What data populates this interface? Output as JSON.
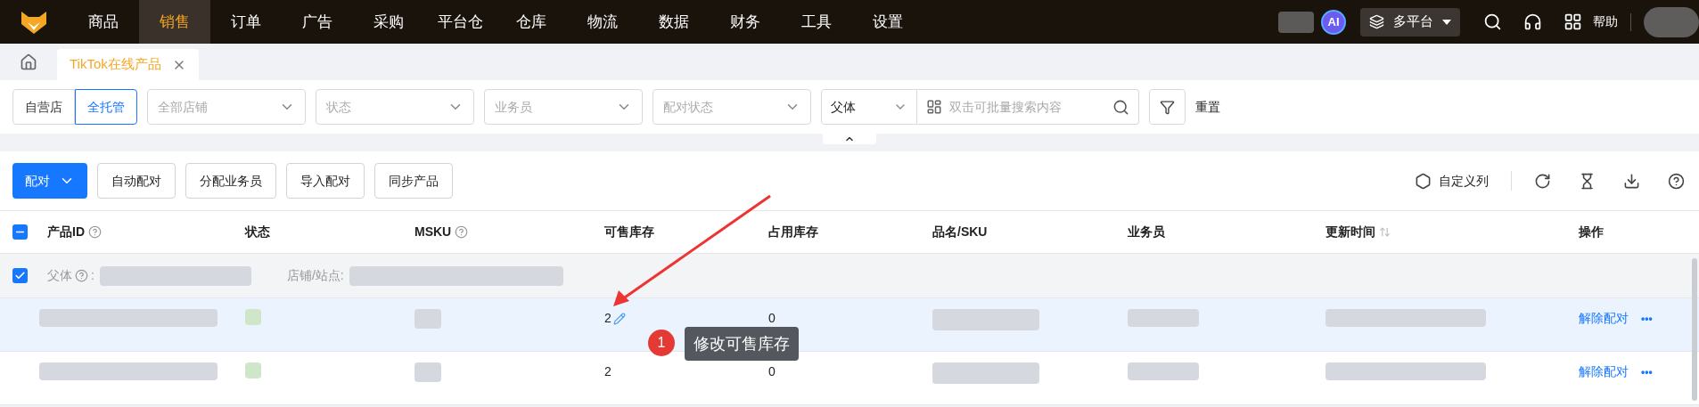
{
  "nav": {
    "items": [
      {
        "label": "商品",
        "selected": false
      },
      {
        "label": "销售",
        "selected": true
      },
      {
        "label": "订单",
        "selected": false
      },
      {
        "label": "广告",
        "selected": false
      },
      {
        "label": "采购",
        "selected": false
      },
      {
        "label": "平台仓",
        "selected": false
      },
      {
        "label": "仓库",
        "selected": false
      },
      {
        "label": "物流",
        "selected": false
      },
      {
        "label": "数据",
        "selected": false
      },
      {
        "label": "财务",
        "selected": false
      },
      {
        "label": "工具",
        "selected": false
      },
      {
        "label": "设置",
        "selected": false
      }
    ],
    "ai_badge": "AI",
    "platform": "多平台",
    "help": "帮助"
  },
  "tabs": [
    {
      "label": "TikTok在线产品",
      "selected": true
    }
  ],
  "filters": {
    "segments": [
      {
        "label": "自营店",
        "selected": false
      },
      {
        "label": "全托管",
        "selected": true
      }
    ],
    "selects": [
      {
        "placeholder": "全部店铺"
      },
      {
        "placeholder": "状态"
      },
      {
        "placeholder": "业务员"
      },
      {
        "placeholder": "配对状态"
      }
    ],
    "search_type": "父体",
    "search_placeholder": "双击可批量搜索内容",
    "reset": "重置"
  },
  "actions": {
    "primary": "配对",
    "buttons": [
      "自动配对",
      "分配业务员",
      "导入配对",
      "同步产品"
    ],
    "custom_columns": "自定义列"
  },
  "table": {
    "header_indeterminate": true,
    "columns": [
      {
        "label": "产品ID",
        "help": true,
        "sortable": false
      },
      {
        "label": "状态",
        "help": false,
        "sortable": false
      },
      {
        "label": "MSKU",
        "help": true,
        "sortable": false
      },
      {
        "label": "可售库存",
        "help": false,
        "sortable": false
      },
      {
        "label": "占用库存",
        "help": false,
        "sortable": false
      },
      {
        "label": "品名/SKU",
        "help": false,
        "sortable": false
      },
      {
        "label": "业务员",
        "help": false,
        "sortable": false
      },
      {
        "label": "更新时间",
        "help": false,
        "sortable": true
      },
      {
        "label": "操作",
        "help": false,
        "sortable": false
      }
    ],
    "group": {
      "checked": true,
      "parent_label": "父体",
      "parent_colon": ":",
      "store_label": "店铺/站点:"
    },
    "rows": [
      {
        "highlighted": true,
        "stock": "2",
        "edit_icon": true,
        "occupied": "0",
        "action": "解除配对",
        "more": "•••"
      },
      {
        "highlighted": false,
        "stock": "2",
        "edit_icon": false,
        "occupied": "0",
        "action": "解除配对",
        "more": "•••"
      }
    ]
  },
  "annotation": {
    "number": "1",
    "text": "修改可售库存"
  }
}
